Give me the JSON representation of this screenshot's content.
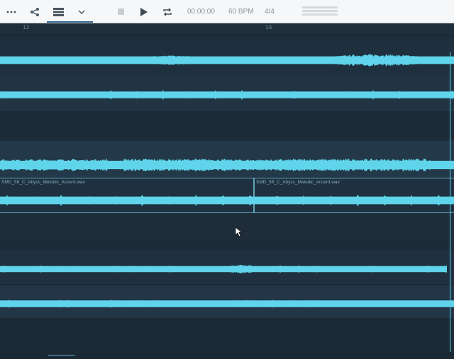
{
  "toolbar": {
    "icons": {
      "more": "more-horizontal-icon",
      "share": "share-icon",
      "tracks": "tracks-list-icon",
      "dropdown": "chevron-down-icon",
      "stop": "stop-icon",
      "play": "play-icon",
      "loop": "loop-icon"
    },
    "time": "00:00:00",
    "tempo": "60 BPM",
    "signature": "4/4"
  },
  "ruler": {
    "marks": [
      "12",
      "16"
    ]
  },
  "clips": [
    {
      "label": "SMD_58_C_Abyss_Melodic_Accent.wav"
    },
    {
      "label": "SMD_58_C_Abyss_Melodic_Accent.wav"
    }
  ],
  "colors": {
    "waveform": "#5fd4ea",
    "background": "#1c2b37",
    "toolbar": "#f6f7f8"
  }
}
